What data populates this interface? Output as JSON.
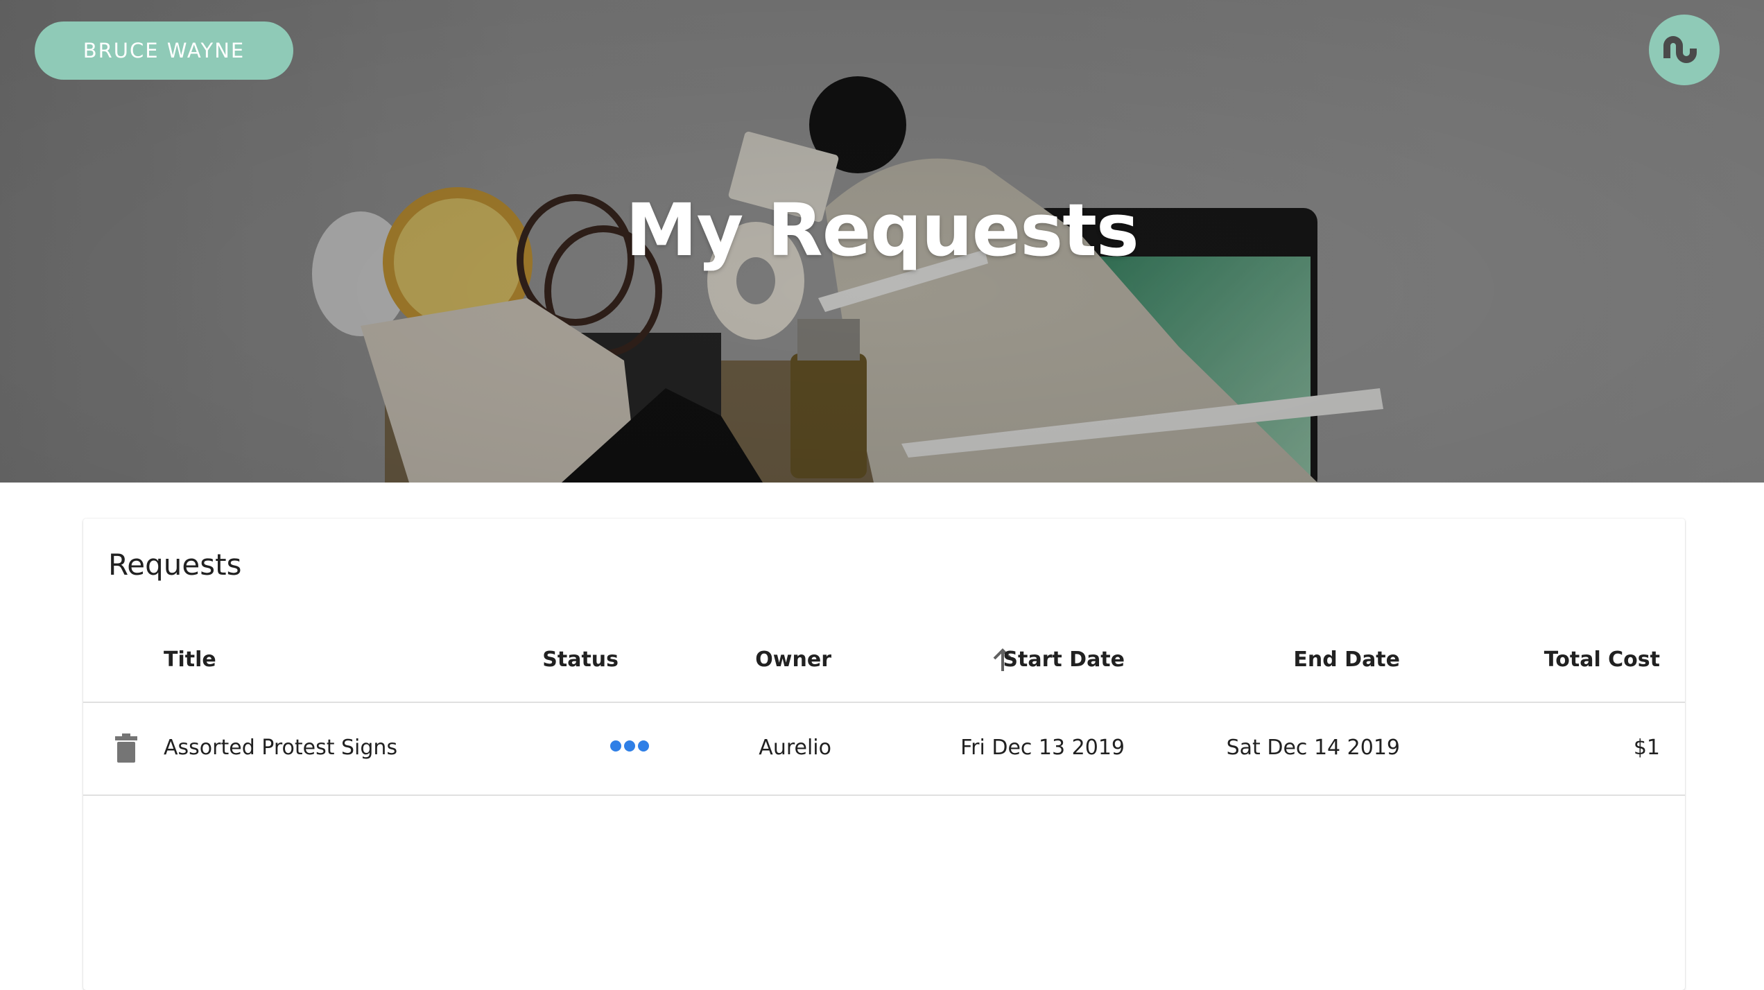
{
  "header": {
    "user_name": "BRUCE WAYNE",
    "title": "My Requests",
    "logo_icon": "stumbleupon-icon"
  },
  "colors": {
    "accent": "#8fcab7",
    "status_dot": "#2f7fe6",
    "text": "#212121"
  },
  "requests": {
    "title": "Requests",
    "sort": {
      "column": "Start Date",
      "direction": "ascending",
      "icon": "arrow-up-icon"
    },
    "columns": {
      "title": "Title",
      "status": "Status",
      "owner": "Owner",
      "start_date": "Start Date",
      "end_date": "End Date",
      "total_cost": "Total Cost"
    },
    "rows": [
      {
        "title": "Assorted Protest Signs",
        "status_icon": "pending-dots-icon",
        "owner": "Aurelio",
        "start_date": "Fri Dec 13 2019",
        "end_date": "Sat Dec 14 2019",
        "total_cost": "$1",
        "action_icon": "trash-icon"
      }
    ]
  }
}
